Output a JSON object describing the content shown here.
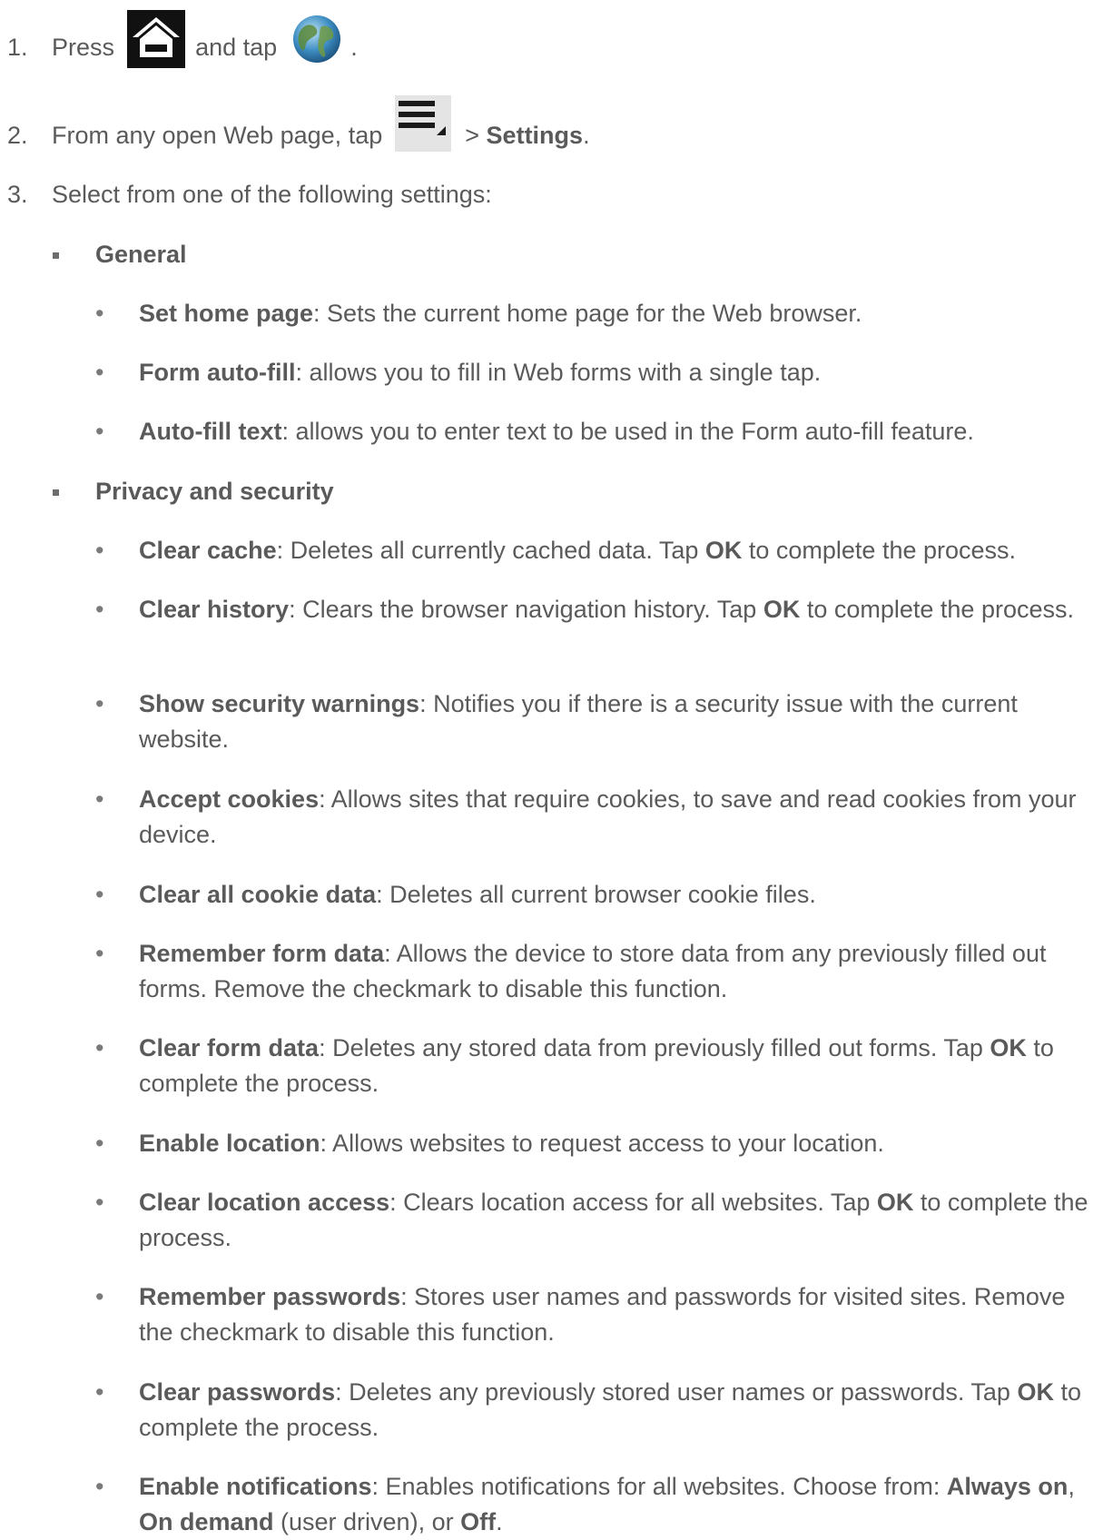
{
  "steps": [
    {
      "number": "1.",
      "text_before": "Press",
      "text_middle": "and tap",
      "text_after": ".",
      "icons": [
        "home-icon",
        "browser-globe-icon"
      ]
    },
    {
      "number": "2.",
      "text_before": "From any open Web page, tap",
      "text_after": " > ",
      "bold": "Settings",
      "period": ".",
      "icons": [
        "menu-icon"
      ]
    },
    {
      "number": "3.",
      "text": "Select from one of the following settings:"
    }
  ],
  "sections": [
    {
      "title": "General",
      "items": [
        {
          "term": "Set home page",
          "desc": ": Sets the current home page for the Web browser."
        },
        {
          "term": "Form auto-fill",
          "desc": ": allows you to fill in Web forms with a single tap."
        },
        {
          "term": "Auto-fill text",
          "desc": ": allows you to enter text to be used in the Form auto-fill feature."
        }
      ]
    },
    {
      "title": "Privacy and security",
      "items": [
        {
          "term": "Clear cache",
          "desc1": ": Deletes all currently cached data. Tap ",
          "b1": "OK",
          "desc2": " to complete the process."
        },
        {
          "term": "Clear history",
          "desc1": ": Clears the browser navigation history. Tap ",
          "b1": "OK",
          "desc2": " to complete the process."
        },
        {
          "term": "Show security warnings",
          "desc": ": Notifies you if there is a security issue with the current website."
        },
        {
          "term": "Accept cookies",
          "desc": ": Allows sites that require cookies, to save and read cookies from your device."
        },
        {
          "term": "Clear all cookie data",
          "desc": ": Deletes all current browser cookie files."
        },
        {
          "term": "Remember form data",
          "desc": ": Allows the device to store data from any previously filled out forms. Remove the checkmark to disable this function."
        },
        {
          "term": "Clear form data",
          "desc1": ": Deletes any stored data from previously filled out forms. Tap ",
          "b1": "OK",
          "desc2": " to complete the process."
        },
        {
          "term": "Enable location",
          "desc": ": Allows websites to request access to your location."
        },
        {
          "term": "Clear location access",
          "desc1": ": Clears location access for all websites. Tap ",
          "b1": "OK",
          "desc2": " to complete the process."
        },
        {
          "term": "Remember passwords",
          "desc": ": Stores user names and passwords for visited sites. Remove the checkmark to disable this function."
        },
        {
          "term": "Clear passwords",
          "desc1": ": Deletes any previously stored user names or passwords. Tap ",
          "b1": "OK",
          "desc2": " to complete the process."
        },
        {
          "term": "Enable notifications",
          "desc1": ": Enables notifications for all websites. Choose from: ",
          "b1": "Always on",
          "sep1": ", ",
          "b2": "On demand",
          "desc2": " (user driven), or ",
          "b3": "Off",
          "end": "."
        }
      ]
    }
  ],
  "bullet_char": "•"
}
